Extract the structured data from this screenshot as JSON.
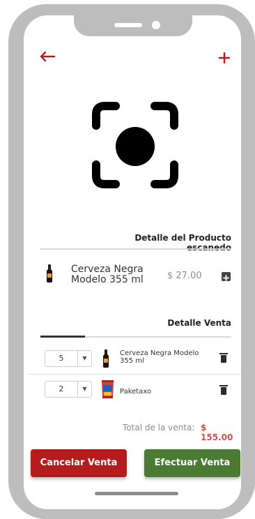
{
  "header": {
    "back_icon": "arrow-left-icon",
    "add_icon": "plus-icon"
  },
  "scanner": {
    "icon": "camera-scan-icon"
  },
  "scanned": {
    "section_title": "Detalle del Producto escanedo",
    "product_name_line1": "Cerveza Negra",
    "product_name_line2": "Modelo 355 ml",
    "price": "$ 27.00",
    "add_icon": "add-square-icon"
  },
  "sale": {
    "section_title": "Detalle Venta",
    "items": [
      {
        "qty": "5",
        "name_line1": "Cerveza Negra Modelo",
        "name_line2": "355 ml",
        "image": "beer-bottle"
      },
      {
        "qty": "2",
        "name_line1": "Paketaxo",
        "name_line2": "",
        "image": "chips-bag"
      }
    ],
    "total_label": "Total de la venta:",
    "total_value": "$ 155.00"
  },
  "actions": {
    "cancel_label": "Cancelar Venta",
    "confirm_label": "Efectuar Venta"
  },
  "colors": {
    "accent_red": "#b31d1d",
    "confirm_green": "#4a7a34",
    "total_red": "#e04a4a",
    "muted_text": "#8c8c8c"
  }
}
